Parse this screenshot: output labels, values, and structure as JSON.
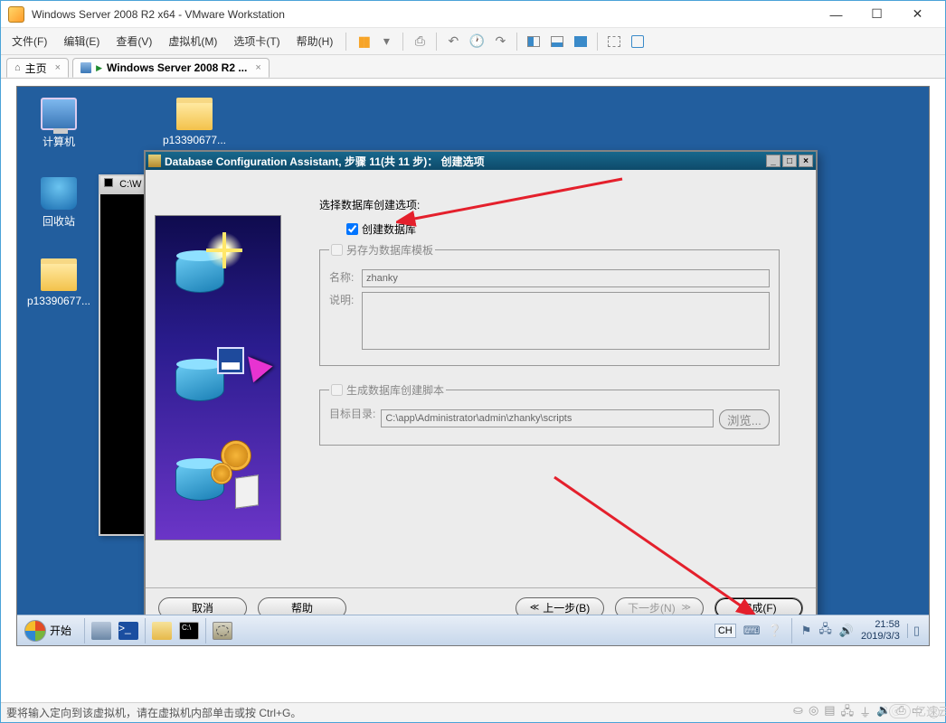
{
  "vmware": {
    "title": "Windows Server 2008 R2 x64 - VMware Workstation",
    "menus": {
      "file": "文件(F)",
      "edit": "编辑(E)",
      "view": "查看(V)",
      "vm": "虚拟机(M)",
      "tabs": "选项卡(T)",
      "help": "帮助(H)"
    },
    "tabs": {
      "home": "主页",
      "vm": "Windows Server 2008 R2 ..."
    },
    "status": "要将输入定向到该虚拟机，请在虚拟机内部单击或按 Ctrl+G。"
  },
  "desktop": {
    "computer": "计算机",
    "recycle": "回收站",
    "folder": "p13390677...",
    "folder2": "p13390677..."
  },
  "cmd": {
    "title": "C:\\W"
  },
  "dca": {
    "title": "Database Configuration Assistant, 步骤 11(共 11 步)： 创建选项",
    "heading": "选择数据库创建选项:",
    "create_db": "创建数据库",
    "save_template": "另存为数据库模板",
    "name_label": "名称:",
    "name_value": "zhanky",
    "desc_label": "说明:",
    "gen_scripts": "生成数据库创建脚本",
    "dest_label": "目标目录:",
    "dest_value": "C:\\app\\Administrator\\admin\\zhanky\\scripts",
    "browse": "浏览...",
    "buttons": {
      "cancel": "取消",
      "help": "帮助",
      "back": "上一步(B)",
      "next": "下一步(N)",
      "finish": "完成(F)"
    }
  },
  "taskbar": {
    "start": "开始",
    "lang": "CH",
    "time": "21:58",
    "date": "2019/3/3"
  },
  "watermark": "亿速云"
}
